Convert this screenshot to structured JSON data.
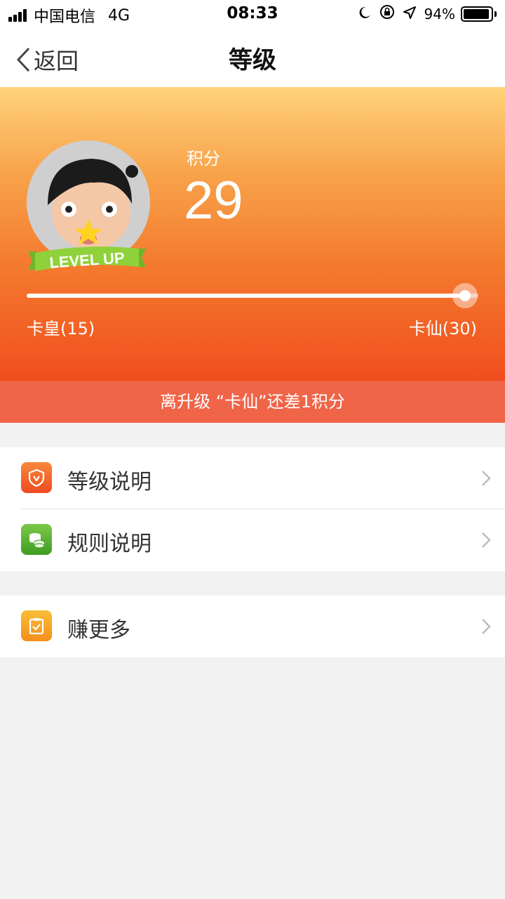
{
  "status_bar": {
    "carrier": "中国电信",
    "network": "4G",
    "time": "08:33",
    "battery_percent": "94%",
    "battery_level": 0.94
  },
  "nav": {
    "back_label": "返回",
    "title": "等级"
  },
  "hero": {
    "badge_text": "LEVEL UP",
    "score_label": "积分",
    "score_value": "29",
    "current_level": "卡皇(15)",
    "next_level": "卡仙(30)",
    "progress": 0.97
  },
  "notice": {
    "text": "离升级 “卡仙”还差1积分"
  },
  "menu": {
    "group1": [
      {
        "label": "等级说明",
        "icon": "shield-icon",
        "color": "#f2542a"
      },
      {
        "label": "规则说明",
        "icon": "coins-icon",
        "color": "#4caf2a"
      }
    ],
    "group2": [
      {
        "label": "赚更多",
        "icon": "clipboard-icon",
        "color": "#f8a31f"
      }
    ]
  }
}
